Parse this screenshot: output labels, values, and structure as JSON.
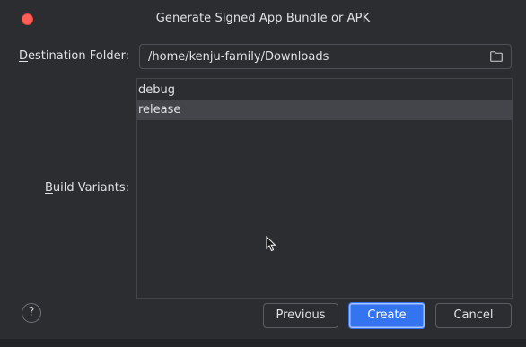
{
  "window": {
    "title": "Generate Signed App Bundle or APK"
  },
  "destination": {
    "label_mnemonic": "D",
    "label_rest": "estination Folder:",
    "value": "/home/kenju-family/Downloads",
    "folder_icon": "folder-icon"
  },
  "build_variants": {
    "label_mnemonic": "B",
    "label_rest": "uild Variants:",
    "items": [
      {
        "label": "debug",
        "selected": false
      },
      {
        "label": "release",
        "selected": true
      }
    ]
  },
  "footer": {
    "help_label": "?",
    "previous_label": "Previous",
    "create_label": "Create",
    "cancel_label": "Cancel"
  },
  "colors": {
    "close_button": "#ff5f57",
    "accent": "#3574f0",
    "selection": "#43454a",
    "background": "#2b2d30"
  }
}
